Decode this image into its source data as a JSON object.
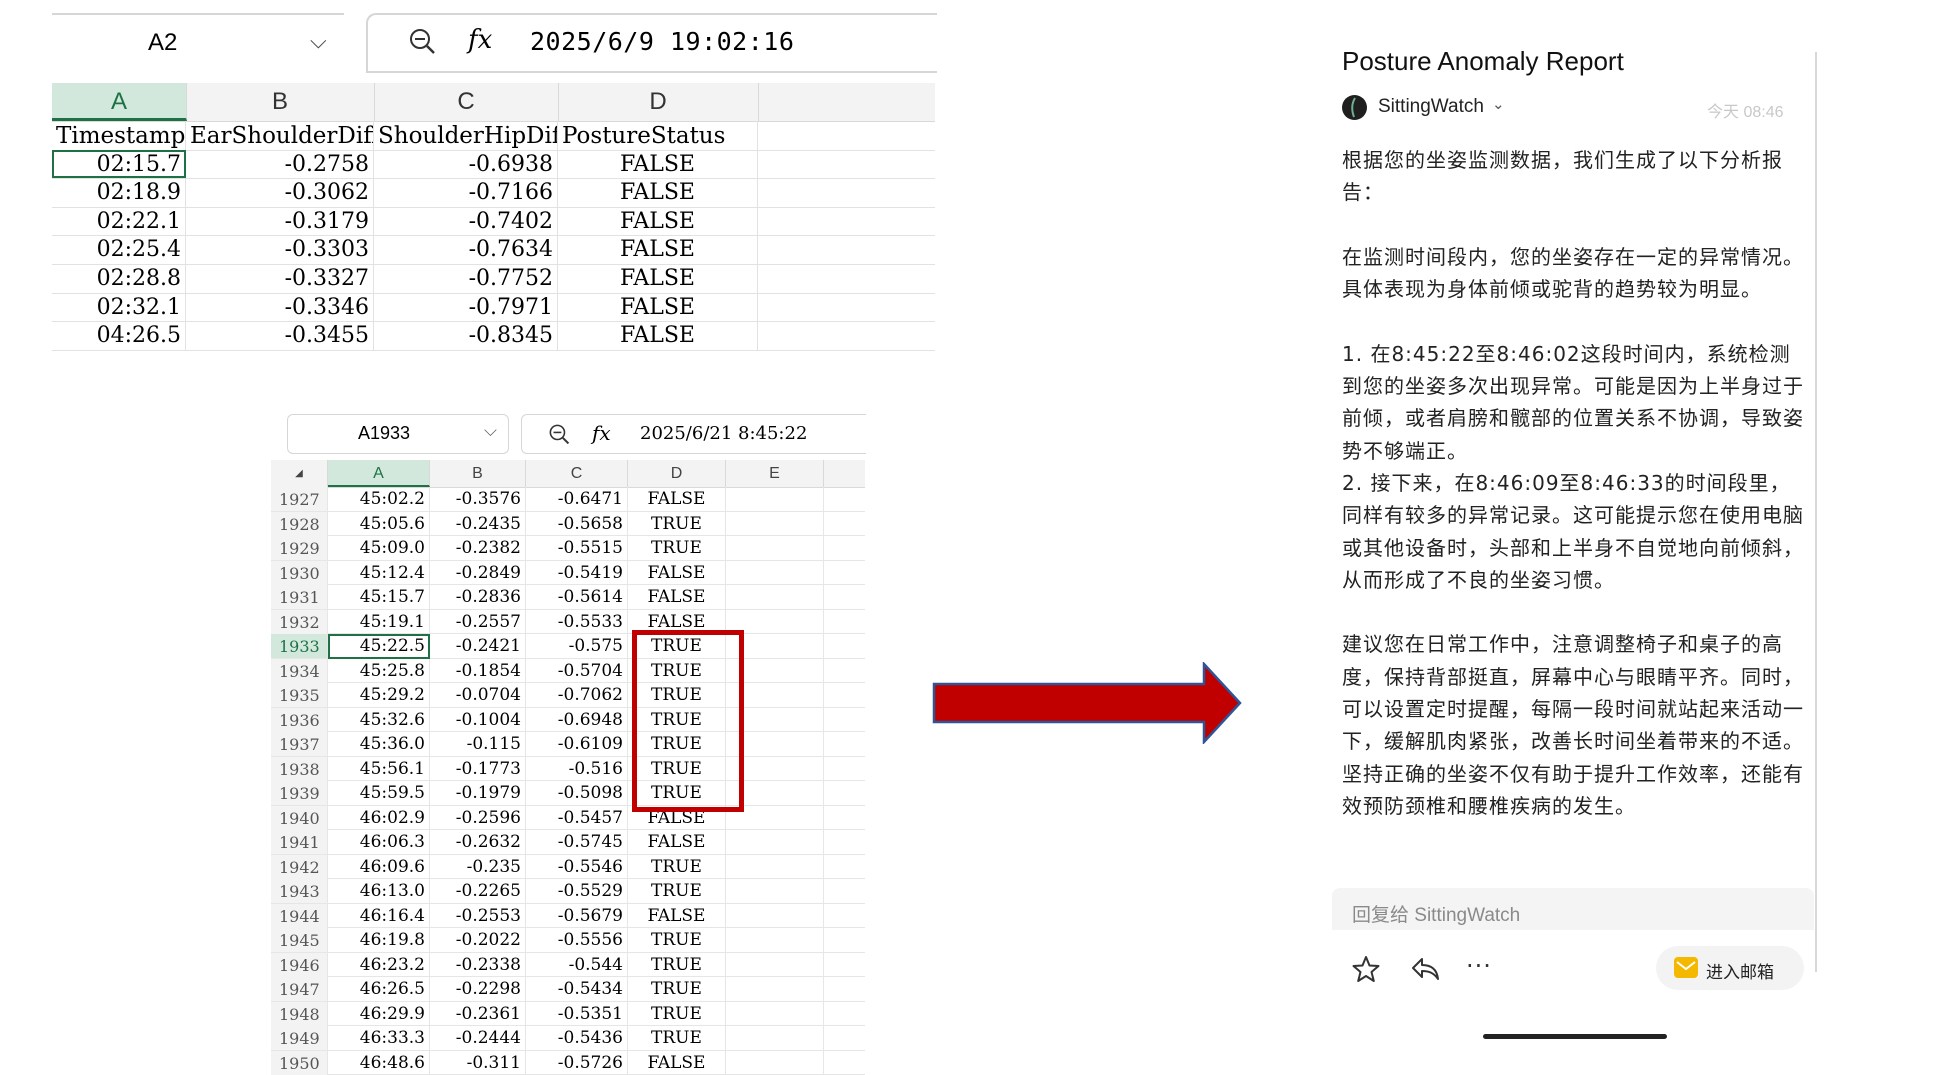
{
  "sheet1": {
    "name_box": "A2",
    "formula": "2025/6/9 19:02:16",
    "columns": [
      "A",
      "B",
      "C",
      "D"
    ],
    "header_row": [
      "Timestamp",
      "EarShoulderDiff",
      "ShoulderHipDiff",
      "PostureStatus"
    ],
    "rows": [
      [
        "02:15.7",
        "-0.2758",
        "-0.6938",
        "FALSE"
      ],
      [
        "02:18.9",
        "-0.3062",
        "-0.7166",
        "FALSE"
      ],
      [
        "02:22.1",
        "-0.3179",
        "-0.7402",
        "FALSE"
      ],
      [
        "02:25.4",
        "-0.3303",
        "-0.7634",
        "FALSE"
      ],
      [
        "02:28.8",
        "-0.3327",
        "-0.7752",
        "FALSE"
      ],
      [
        "02:32.1",
        "-0.3346",
        "-0.7971",
        "FALSE"
      ],
      [
        "04:26.5",
        "-0.3455",
        "-0.8345",
        "FALSE"
      ]
    ]
  },
  "sheet2": {
    "name_box": "A1933",
    "formula": "2025/6/21 8:45:22",
    "columns": [
      "A",
      "B",
      "C",
      "D",
      "E"
    ],
    "corner": "◢",
    "rows": [
      [
        "1927",
        "45:02.2",
        "-0.3576",
        "-0.6471",
        "FALSE"
      ],
      [
        "1928",
        "45:05.6",
        "-0.2435",
        "-0.5658",
        "TRUE"
      ],
      [
        "1929",
        "45:09.0",
        "-0.2382",
        "-0.5515",
        "TRUE"
      ],
      [
        "1930",
        "45:12.4",
        "-0.2849",
        "-0.5419",
        "FALSE"
      ],
      [
        "1931",
        "45:15.7",
        "-0.2836",
        "-0.5614",
        "FALSE"
      ],
      [
        "1932",
        "45:19.1",
        "-0.2557",
        "-0.5533",
        "FALSE"
      ],
      [
        "1933",
        "45:22.5",
        "-0.2421",
        "-0.575",
        "TRUE"
      ],
      [
        "1934",
        "45:25.8",
        "-0.1854",
        "-0.5704",
        "TRUE"
      ],
      [
        "1935",
        "45:29.2",
        "-0.0704",
        "-0.7062",
        "TRUE"
      ],
      [
        "1936",
        "45:32.6",
        "-0.1004",
        "-0.6948",
        "TRUE"
      ],
      [
        "1937",
        "45:36.0",
        "-0.115",
        "-0.6109",
        "TRUE"
      ],
      [
        "1938",
        "45:56.1",
        "-0.1773",
        "-0.516",
        "TRUE"
      ],
      [
        "1939",
        "45:59.5",
        "-0.1979",
        "-0.5098",
        "TRUE"
      ],
      [
        "1940",
        "46:02.9",
        "-0.2596",
        "-0.5457",
        "FALSE"
      ],
      [
        "1941",
        "46:06.3",
        "-0.2632",
        "-0.5745",
        "FALSE"
      ],
      [
        "1942",
        "46:09.6",
        "-0.235",
        "-0.5546",
        "TRUE"
      ],
      [
        "1943",
        "46:13.0",
        "-0.2265",
        "-0.5529",
        "TRUE"
      ],
      [
        "1944",
        "46:16.4",
        "-0.2553",
        "-0.5679",
        "FALSE"
      ],
      [
        "1945",
        "46:19.8",
        "-0.2022",
        "-0.5556",
        "TRUE"
      ],
      [
        "1946",
        "46:23.2",
        "-0.2338",
        "-0.544",
        "TRUE"
      ],
      [
        "1947",
        "46:26.5",
        "-0.2298",
        "-0.5434",
        "TRUE"
      ],
      [
        "1948",
        "46:29.9",
        "-0.2361",
        "-0.5351",
        "TRUE"
      ],
      [
        "1949",
        "46:33.3",
        "-0.2444",
        "-0.5436",
        "TRUE"
      ],
      [
        "1950",
        "46:48.6",
        "-0.311",
        "-0.5726",
        "FALSE"
      ]
    ]
  },
  "email": {
    "title": "Posture Anomaly Report",
    "sender": "SittingWatch",
    "time": "今天 08:46",
    "body": [
      "根据您的坐姿监测数据，我们生成了以下分析报告：",
      "",
      "在监测时间段内，您的坐姿存在一定的异常情况。具体表现为身体前倾或驼背的趋势较为明显。",
      "",
      "1. 在8:45:22至8:46:02这段时间内，系统检测到您的坐姿多次出现异常。可能是因为上半身过于前倾，或者肩膀和髋部的位置关系不协调，导致姿势不够端正。",
      "2. 接下来，在8:46:09至8:46:33的时间段里，同样有较多的异常记录。这可能提示您在使用电脑或其他设备时，头部和上半身不自觉地向前倾斜，从而形成了不良的坐姿习惯。",
      "",
      "建议您在日常工作中，注意调整椅子和桌子的高度，保持背部挺直，屏幕中心与眼睛平齐。同时，可以设置定时提醒，每隔一段时间就站起来活动一下，缓解肌肉紧张，改善长时间坐着带来的不适。坚持正确的坐姿不仅有助于提升工作效率，还能有效预防颈椎和腰椎疾病的发生。"
    ],
    "reply_placeholder": "回复给 SittingWatch",
    "more_label": "···",
    "mailbox_label": "进入邮箱"
  },
  "colors": {
    "excel_green": "#1e7145",
    "highlight_red": "#c00000",
    "arrow_fill": "#c00000",
    "arrow_stroke": "#2f5597",
    "mailbox_yellow": "#f5b800"
  },
  "icons": {
    "zoom": "zoom-out-icon",
    "fx": "fx-icon",
    "star": "star-icon",
    "reply": "reply-icon",
    "mailbox": "mailbox-icon"
  }
}
